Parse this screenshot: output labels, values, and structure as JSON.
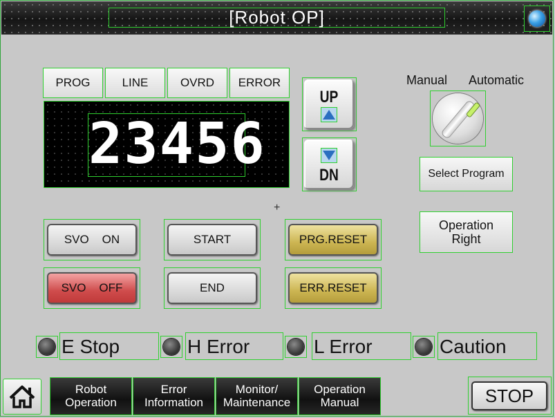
{
  "window": {
    "title": "[Robot OP]",
    "globe_icon": "globe-icon"
  },
  "monitor": {
    "tabs": [
      "PROG",
      "LINE",
      "OVRD",
      "ERROR"
    ],
    "display_value": "23456"
  },
  "jog": {
    "up_label": "UP",
    "down_label": "DN"
  },
  "mode": {
    "manual_label": "Manual",
    "automatic_label": "Automatic",
    "knob_position": "automatic"
  },
  "right_panel": {
    "select_program": "Select Program",
    "operation_right": "Operation Right"
  },
  "controls": {
    "svo_on": "SVO    ON",
    "svo_off": "SVO    OFF",
    "start": "START",
    "end": "END",
    "prg_reset": "PRG.RESET",
    "err_reset": "ERR.RESET"
  },
  "indicators": [
    "E Stop",
    "H Error",
    "L Error",
    "Caution"
  ],
  "nav": {
    "home_icon": "home-icon",
    "items": [
      {
        "line1": "Robot",
        "line2": "Operation"
      },
      {
        "line1": "Error",
        "line2": "Information"
      },
      {
        "line1": "Monitor/",
        "line2": "Maintenance"
      },
      {
        "line1": "Operation",
        "line2": "Manual"
      }
    ],
    "stop": "STOP"
  },
  "colors": {
    "frame": "#2ea53a",
    "svo_off": "#cf4c4c",
    "reset": "#ccb552"
  }
}
